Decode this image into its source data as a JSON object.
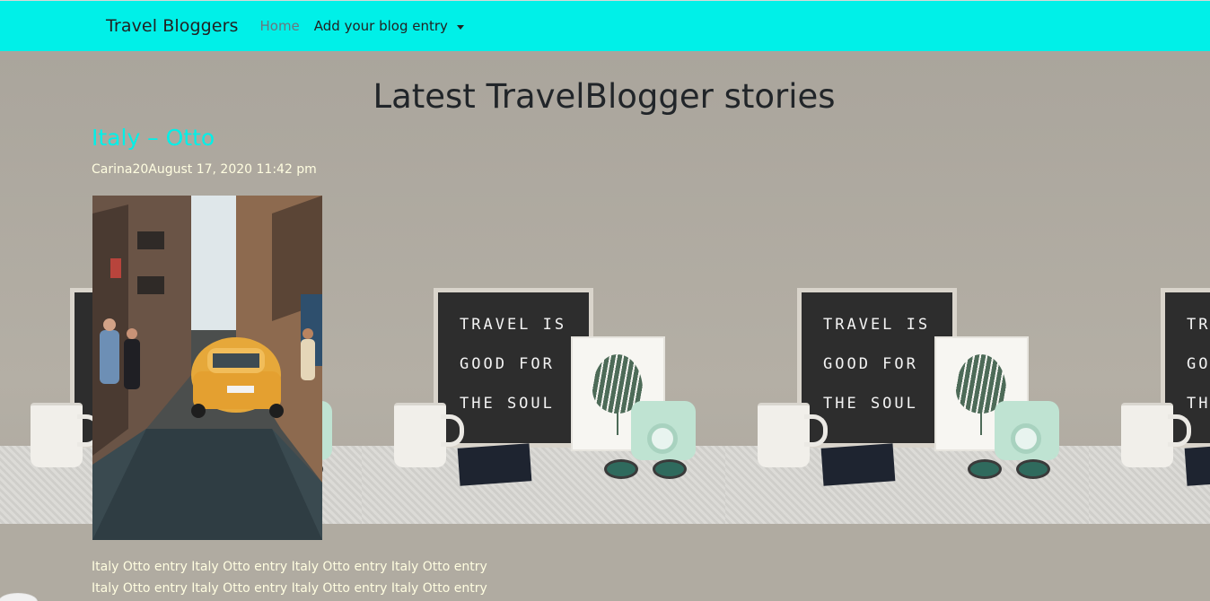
{
  "navbar": {
    "brand": "Travel Bloggers",
    "home_label": "Home",
    "dropdown_label": "Add your blog entry",
    "background_color": "#00f0e8"
  },
  "background": {
    "letter_board": [
      "TRAVEL IS",
      "GOOD FOR",
      "THE SOUL"
    ]
  },
  "main": {
    "heading": "Latest TravelBlogger stories",
    "posts": [
      {
        "title": "Italy – Otto",
        "meta": "Carina20August 17, 2020 11:42 pm",
        "image_alt": "Street with a yellow vintage car in Italy",
        "body_lines": [
          "Italy Otto entry Italy Otto entry Italy Otto entry Italy Otto entry",
          "Italy Otto entry Italy Otto entry Italy Otto entry Italy Otto entry"
        ]
      }
    ]
  },
  "colors": {
    "accent": "#00f0e8",
    "meta_text": "#fffde0",
    "heading_text": "#212529"
  }
}
